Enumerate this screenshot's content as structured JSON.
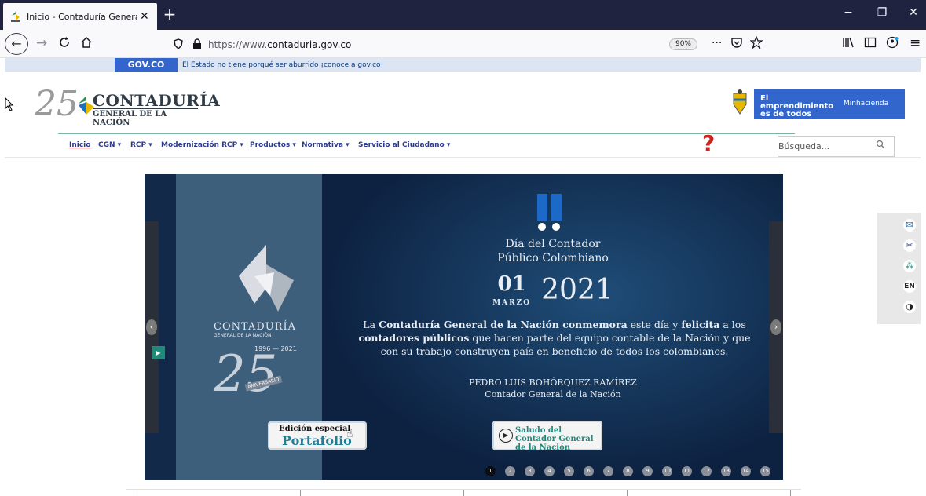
{
  "browser": {
    "tab_title": "Inicio - Contaduría General de l",
    "tab_close": "✕",
    "new_tab": "+",
    "win_min": "−",
    "win_max": "❐",
    "win_close": "✕",
    "url_prefix": "https://www.",
    "url_domain": "contaduria.gov.co",
    "zoom": "90%",
    "more": "···"
  },
  "govco": {
    "logo": "GOV.CO",
    "text": "El Estado no tiene porqué ser aburrido ¡conoce a gov.co!"
  },
  "header": {
    "logo_number": "25",
    "logo_name": "CONTADURÍA",
    "logo_sub": "GENERAL DE LA NACIÓN",
    "emp_text": "El emprendimiento es de todos",
    "ministry": "Minhacienda"
  },
  "menu": {
    "items": [
      "Inicio",
      "CGN ▾",
      "RCP ▾",
      "Modernización RCP ▾",
      "Productos ▾",
      "Normativa ▾",
      "Servicio al Ciudadano ▾"
    ],
    "help": "?",
    "search_placeholder": "Búsqueda..."
  },
  "slide": {
    "left_name": "CONTADURÍA",
    "left_sub": "GENERAL DE LA NACIÓN",
    "left_years": "1996 — 2021",
    "left_25": "25",
    "left_aniv": "ANIVERSARIO",
    "title_line1": "Día del Contador",
    "title_line2": "Público Colombiano",
    "day": "01",
    "month": "MARZO",
    "year": "2021",
    "body_p1": "La ",
    "body_b1": "Contaduría General de la Nación conmemora",
    "body_p2": " este día y ",
    "body_b2": "felicita",
    "body_p3": " a los ",
    "body_b3": "contadores públicos",
    "body_p4": " que hacen parte del equipo contable de la Nación y que con su trabajo construyen país en beneficio de todos los colombianos.",
    "sign_name": "PEDRO LUIS BOHÓRQUEZ RAMÍREZ",
    "sign_role": "Contador General de la Nación",
    "portafolio_top": "Edición especial",
    "portafolio_main": "Portafolio",
    "saludo": "Saludo del Contador General de la Nación",
    "dots": [
      "1",
      "2",
      "3",
      "4",
      "5",
      "6",
      "7",
      "8",
      "9",
      "10",
      "11",
      "12",
      "13",
      "14",
      "15"
    ],
    "active_dot": 1
  },
  "side_tools": {
    "en": "EN"
  },
  "colors": {
    "brand_blue": "#3366cc",
    "menu_text": "#2d3a8c",
    "help_red": "#d61f1f",
    "slide_bg": "#0d2241"
  }
}
